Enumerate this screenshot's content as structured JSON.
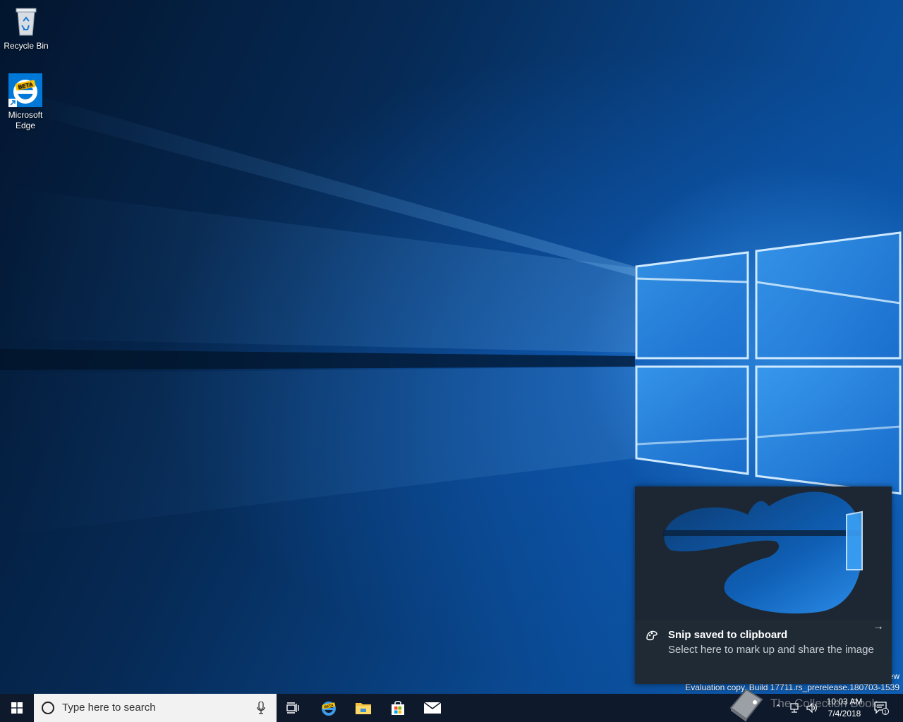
{
  "desktop": {
    "icons": [
      {
        "label": "Recycle Bin",
        "icon": "recycle-bin-icon"
      },
      {
        "label": "Microsoft Edge",
        "icon": "edge-beta-icon"
      }
    ]
  },
  "toast": {
    "title": "Snip saved to clipboard",
    "body": "Select here to mark up and share the image",
    "app_icon": "snip-sketch-icon",
    "expand_icon": "arrow-right-icon"
  },
  "watermark": {
    "line1": "ew",
    "line2": "Evaluation copy. Build 17711.rs_prerelease.180703-1539"
  },
  "taskbar": {
    "search_placeholder": "Type here to search",
    "pinned": [
      "task-view-icon",
      "edge-beta-icon",
      "file-explorer-icon",
      "store-icon",
      "mail-icon"
    ],
    "tray_overlay": "The Collection Book",
    "time": "10:03 AM",
    "date": "7/4/2018",
    "notification_count": "1"
  },
  "colors": {
    "accent": "#0078d7",
    "taskbar": "#0e1a2b",
    "toast_bg": "#1f2a35"
  }
}
